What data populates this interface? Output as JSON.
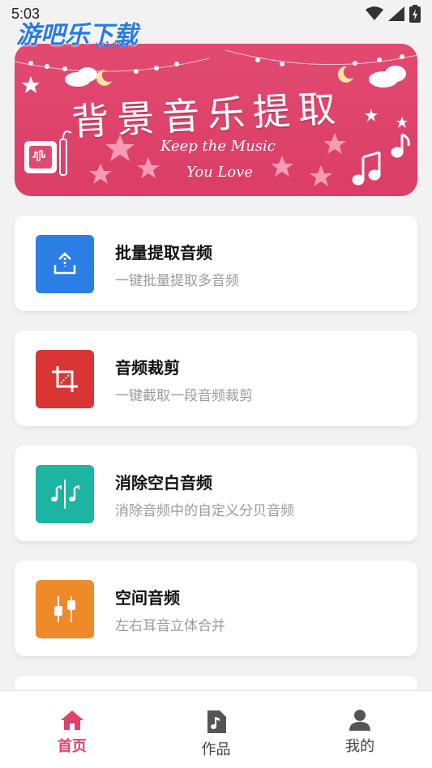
{
  "status_bar": {
    "time": "5:03"
  },
  "watermark": {
    "text": "游吧乐下载",
    "sub": "yb1.com"
  },
  "banner": {
    "title": "背景音乐提取",
    "subtitle_line1": "Keep the Music",
    "subtitle_line2": "You Love"
  },
  "features": [
    {
      "title": "批量提取音频",
      "desc": "一键批量提取多音频",
      "icon": "upload-icon",
      "color": "#2b7ee4"
    },
    {
      "title": "音频裁剪",
      "desc": "一键截取一段音频裁剪",
      "icon": "crop-icon",
      "color": "#d93535"
    },
    {
      "title": "消除空白音频",
      "desc": "消除音频中的自定义分贝音频",
      "icon": "music-split-icon",
      "color": "#1cb5a1"
    },
    {
      "title": "空间音频",
      "desc": "左右耳音立体合并",
      "icon": "equalizer-icon",
      "color": "#ef8a2a"
    }
  ],
  "nav": {
    "items": [
      {
        "label": "首页",
        "icon": "home-icon",
        "active": true
      },
      {
        "label": "作品",
        "icon": "music-file-icon",
        "active": false
      },
      {
        "label": "我的",
        "icon": "person-icon",
        "active": false
      }
    ]
  },
  "colors": {
    "accent": "#e23f6a",
    "banner": "#e24a71"
  }
}
